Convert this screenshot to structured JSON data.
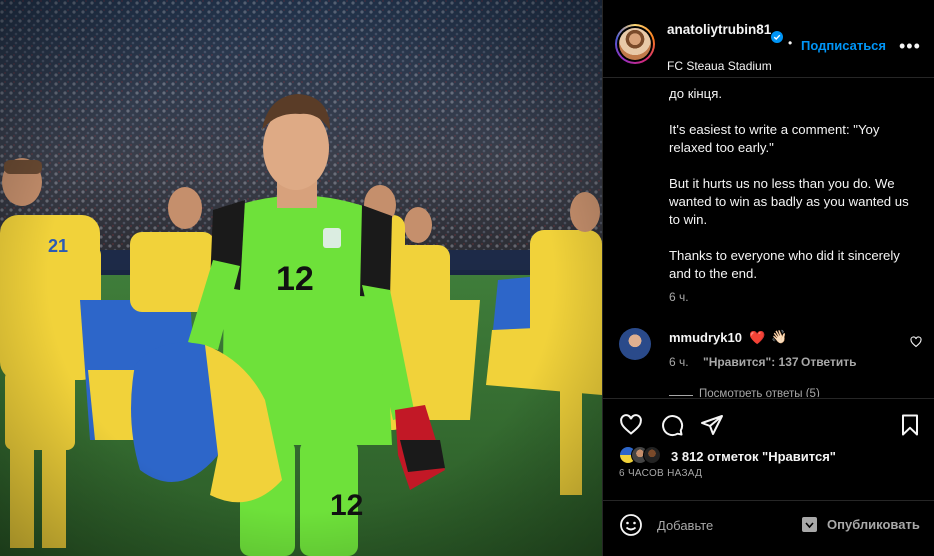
{
  "post": {
    "photo_alt": "Goalkeeper in green kit number 12 walking on the pitch carrying a Ukrainian flag",
    "jersey_number": "12",
    "teammate_number": "21"
  },
  "header": {
    "username": "anatoliytrubin81",
    "separator": "•",
    "follow_label": "Подписаться",
    "more_icon": "more-horizontal-icon",
    "location": "FC Steaua Stadium"
  },
  "caption": {
    "partial_line": "до кінця.",
    "p1": "It's easiest to write a comment: \"Yoy relaxed too early.\"",
    "p2": "But it hurts us no less than you do. We wanted to win as badly as you wanted us to win.",
    "p3": "Thanks to everyone who did it sincerely and to the end.",
    "time": "6 ч."
  },
  "comment": {
    "username": "mmudryk10",
    "emoji_heart": "❤️",
    "emoji_hand": "👋🏻",
    "time": "6 ч.",
    "likes": "\"Нравится\": 137",
    "reply": "Ответить",
    "view_replies": "Посмотреть ответы (5)"
  },
  "actions": {
    "likes_text": "3 812 отметок \"Нравится\"",
    "timestamp": "6 ЧАСОВ НАЗАД"
  },
  "add_comment": {
    "placeholder": "Добавьте",
    "publish_label": "Опубликовать"
  },
  "colors": {
    "accent_blue": "#0095f6",
    "background": "#000000",
    "text_secondary": "#a8a8a8",
    "divider": "#262626"
  }
}
